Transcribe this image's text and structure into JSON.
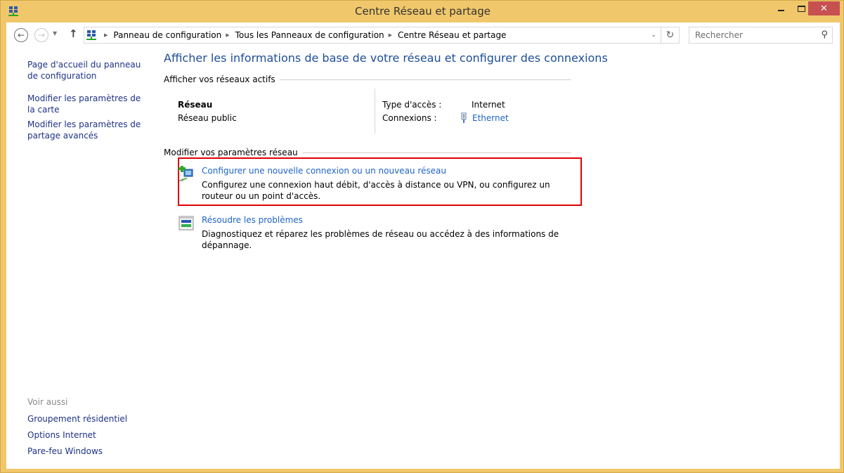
{
  "window": {
    "title": "Centre Réseau et partage",
    "controls": {
      "minimize": "minimize",
      "maximize": "maximize",
      "close": "✕"
    }
  },
  "nav": {
    "back_icon": "←",
    "forward_icon": "→",
    "recent_icon": "▼",
    "up_icon": "↑",
    "breadcrumbs": [
      "Panneau de configuration",
      "Tous les Panneaux de configuration",
      "Centre Réseau et partage"
    ],
    "crumb_separator": "▶",
    "dropdown_icon": "⌄",
    "refresh_icon": "↻",
    "search_placeholder": "Rechercher",
    "search_value": "",
    "search_icon": "⚲"
  },
  "sidebar": {
    "links": [
      "Page d'accueil du panneau de configuration",
      "Modifier les paramètres de la carte",
      "Modifier les paramètres de partage avancés"
    ],
    "see_also_label": "Voir aussi",
    "see_also": [
      "Groupement résidentiel",
      "Options Internet",
      "Pare-feu Windows"
    ]
  },
  "main": {
    "heading": "Afficher les informations de base de votre réseau et configurer des connexions",
    "active_networks_label": "Afficher vos réseaux actifs",
    "network": {
      "name": "Réseau",
      "category": "Réseau public",
      "access_type_label": "Type d'accès :",
      "access_type_value": "Internet",
      "connections_label": "Connexions :",
      "connection_name": "Ethernet"
    },
    "change_settings_label": "Modifier vos paramètres réseau",
    "tasks": [
      {
        "title": "Configurer une nouvelle connexion ou un nouveau réseau",
        "description": "Configurez une connexion haut débit, d'accès à distance ou VPN, ou configurez un routeur ou un point d'accès.",
        "highlighted": true
      },
      {
        "title": "Résoudre les problèmes",
        "description": "Diagnostiquez et réparez les problèmes de réseau ou accédez à des informations de dépannage.",
        "highlighted": false
      }
    ]
  },
  "colors": {
    "frame": "#f0c86b",
    "close_button": "#c75050",
    "link": "#1e64c8",
    "heading": "#1e4d9a",
    "highlight_border": "#e00000"
  }
}
